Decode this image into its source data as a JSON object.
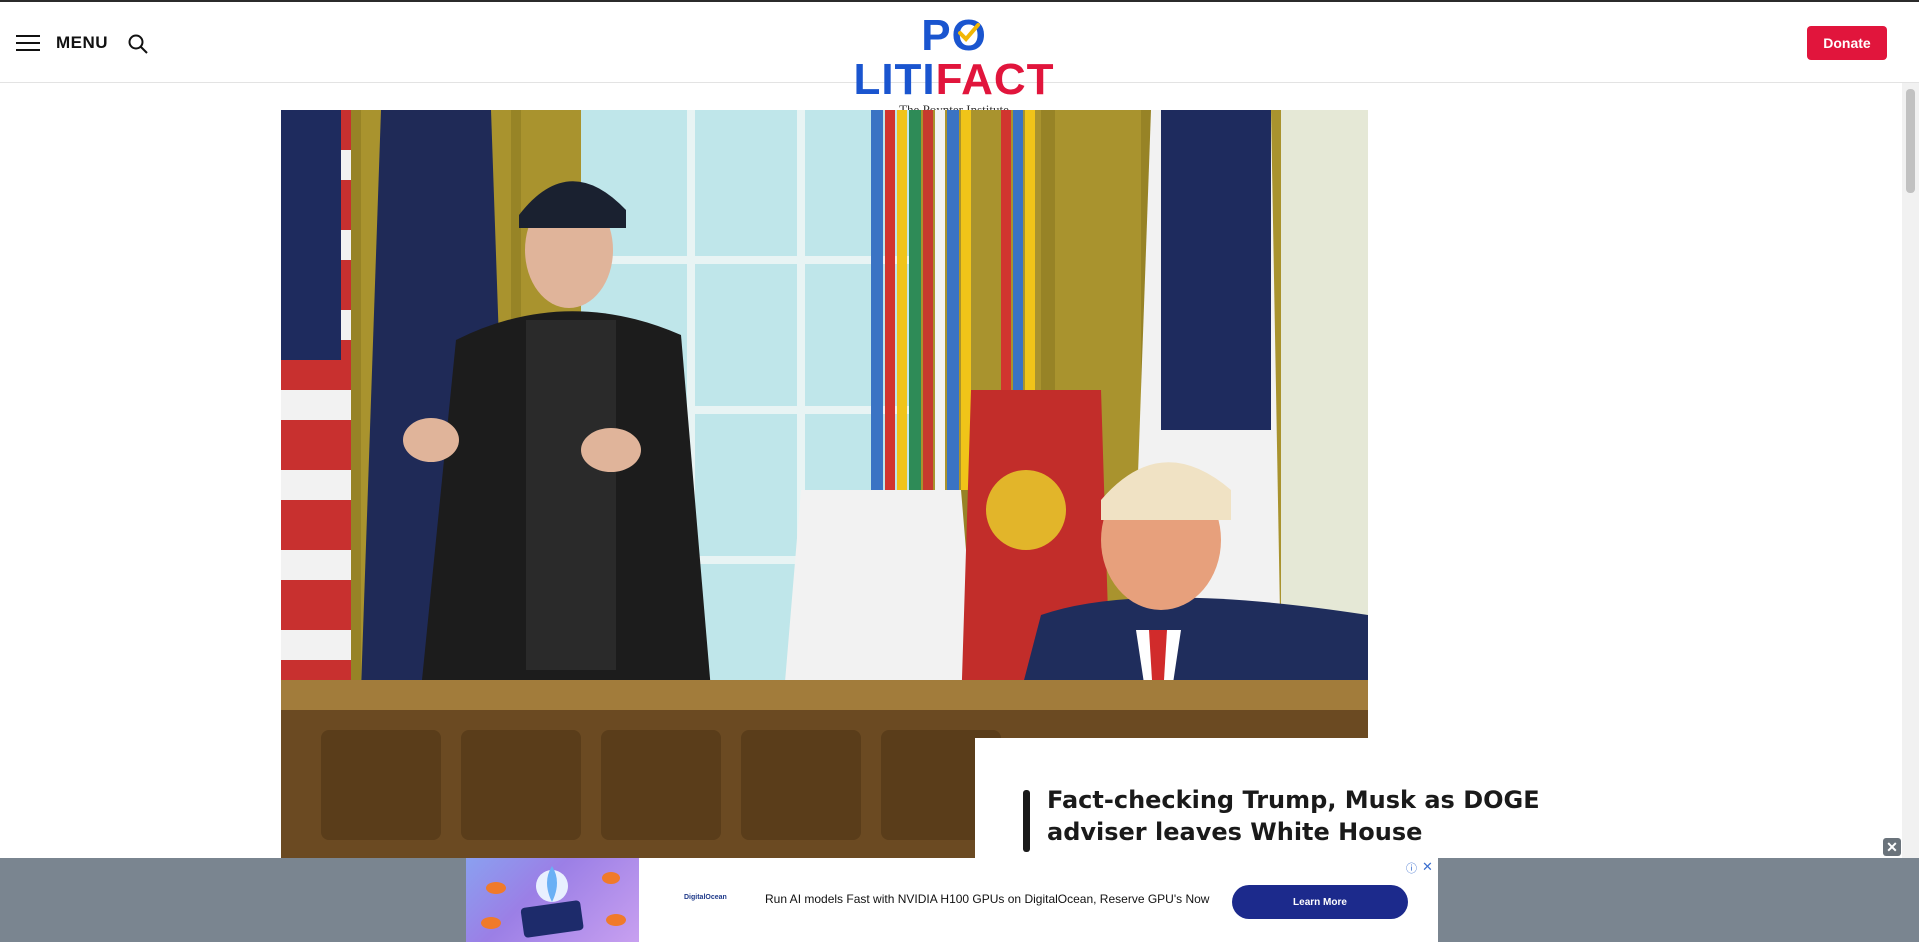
{
  "header": {
    "menu_label": "MENU",
    "logo": {
      "part1": "P",
      "part2": "LITI",
      "part3": "FACT",
      "subtitle": "The Poynter Institute"
    },
    "donate_label": "Donate"
  },
  "article": {
    "headline": "Fact-checking Trump, Musk as DOGE adviser leaves White House"
  },
  "ad": {
    "brand": "DigitalOcean",
    "text": "Run AI models Fast with NVIDIA H100 GPUs on DigitalOcean, Reserve GPU's Now",
    "cta": "Learn More",
    "close_symbol": "✕",
    "info_symbol": "ⓘ"
  },
  "colors": {
    "brand_blue": "#1a55cf",
    "brand_red": "#e1153c",
    "cta_navy": "#1c2a8c"
  }
}
